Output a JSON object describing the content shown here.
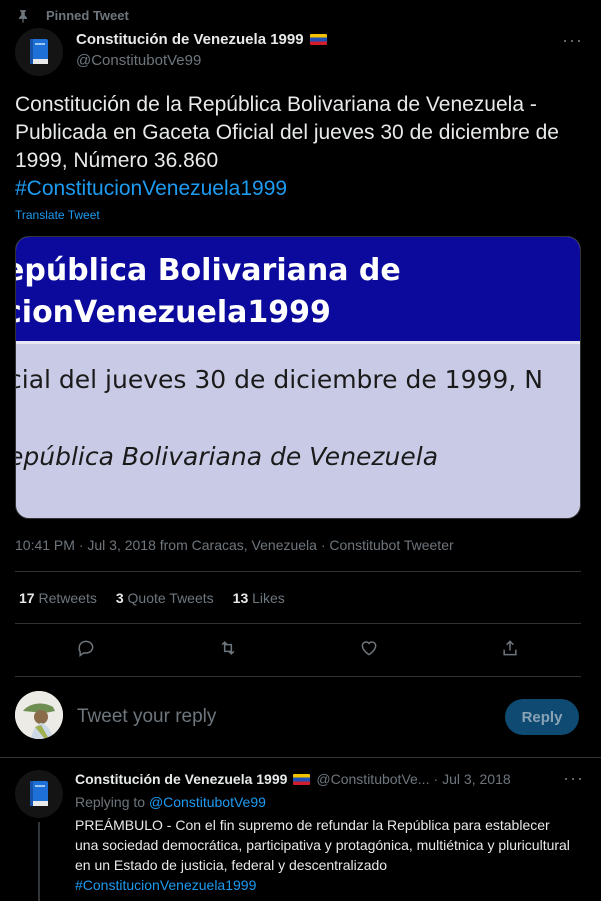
{
  "pinned": {
    "label": "Pinned Tweet",
    "icon": "pin-icon"
  },
  "author": {
    "name": "Constitución de Venezuela 1999",
    "handle": "@ConstitubotVe99",
    "avatar_icon": "blue-book-icon",
    "flag_icon": "venezuela-flag-icon"
  },
  "tweet": {
    "text": "Constitución de la República Bolivariana de Venezuela - Publicada en Gaceta Oficial del jueves 30 de diciembre de 1999, Número 36.860",
    "hashtag": "#ConstitucionVenezuela1999",
    "translate_label": "Translate Tweet",
    "media": {
      "line1": "epública Bolivariana de",
      "line2": "cionVenezuela1999",
      "line3": "cial del jueves 30 de diciembre de 1999, N",
      "line4": "epública Bolivariana de Venezuela"
    },
    "meta": "10:41 PM · Jul 3, 2018 from Caracas, Venezuela · Constitubot Tweeter"
  },
  "stats": {
    "retweets_count": "17",
    "retweets_label": "Retweets",
    "quotes_count": "3",
    "quotes_label": "Quote Tweets",
    "likes_count": "13",
    "likes_label": "Likes"
  },
  "actions": [
    "reply-icon",
    "retweet-icon",
    "like-icon",
    "share-icon"
  ],
  "composer": {
    "placeholder": "Tweet your reply",
    "button": "Reply"
  },
  "reply_tweet": {
    "name": "Constitución de Venezuela 1999",
    "handle": "@ConstitubotVe...",
    "separator": "·",
    "date": "Jul 3, 2018",
    "replying_prefix": "Replying to",
    "replying_to": "@ConstitubotVe99",
    "text": "PREÁMBULO - Con el fin supremo de refundar la República para establecer una sociedad democrática, participativa y protagónica, multiétnica y pluricultural en un Estado de justicia, federal y descentralizado",
    "hashtag": "#ConstitucionVenezuela1999"
  },
  "colors": {
    "accent": "#1d9bf0",
    "background": "#000000",
    "muted": "#6e767d",
    "reply_button": "#0e4a72"
  }
}
